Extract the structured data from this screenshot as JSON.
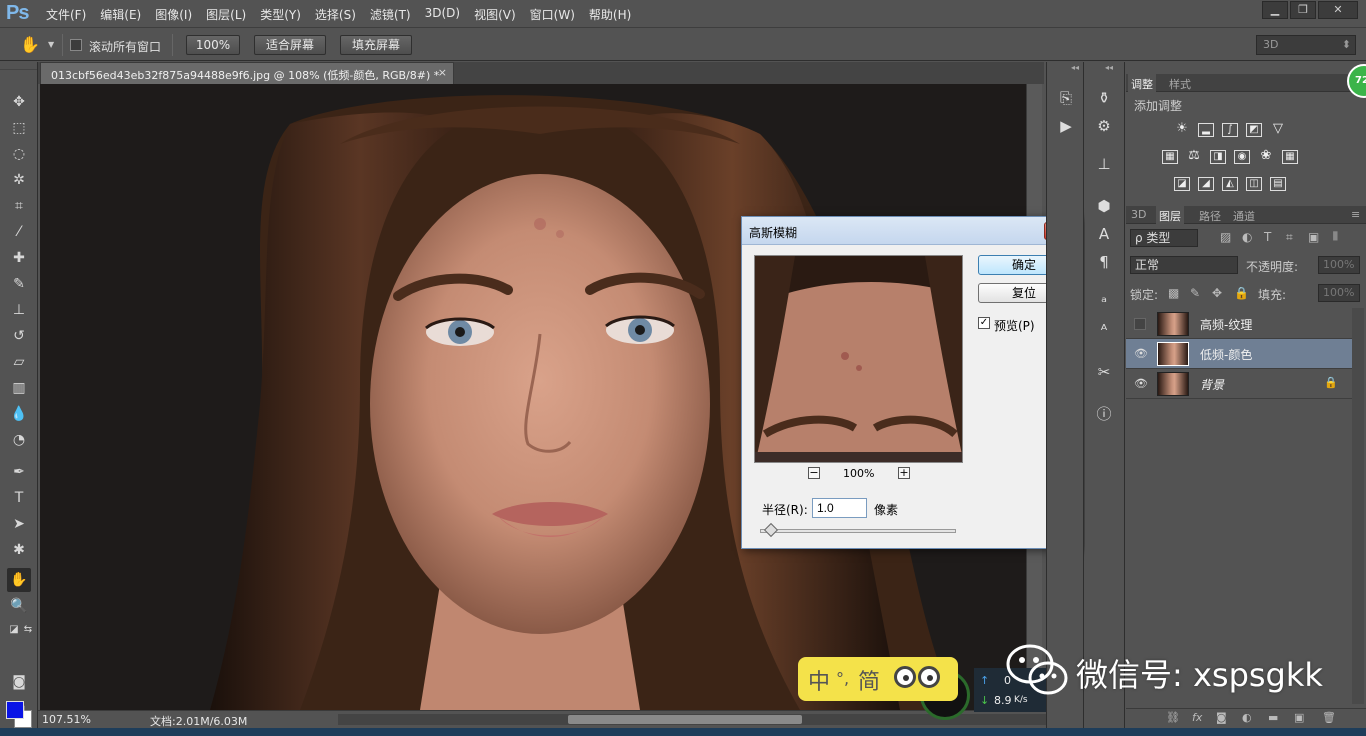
{
  "app": {
    "logo": "Ps"
  },
  "menu": [
    "文件(F)",
    "编辑(E)",
    "图像(I)",
    "图层(L)",
    "类型(Y)",
    "选择(S)",
    "滤镜(T)",
    "3D(D)",
    "视图(V)",
    "窗口(W)",
    "帮助(H)"
  ],
  "window_controls": {
    "minimize": "▁",
    "restore": "❐",
    "close": "✕"
  },
  "options": {
    "scroll_all_label": "滚动所有窗口",
    "zoom_100": "100%",
    "fit_screen": "适合屏幕",
    "fill_screen": "填充屏幕",
    "workspace": "3D"
  },
  "document": {
    "tab_title": "013cbf56ed43eb32f875a94488e9f6.jpg @ 108% (低频-颜色, RGB/8#) *",
    "tab_close": "×"
  },
  "status": {
    "zoom": "107.51%",
    "doc_size": "文档:2.01M/6.03M"
  },
  "dialog": {
    "title": "高斯模糊",
    "close": "✕",
    "ok": "确定",
    "reset": "复位",
    "preview_checked": "✓",
    "preview_label": "预览(P)",
    "zoom_minus": "−",
    "zoom_plus": "+",
    "zoom": "100%",
    "radius_label": "半径(R):",
    "radius_value": "1.0",
    "radius_unit": "像素",
    "radius_slider_fraction": 0.03
  },
  "adjust_panel": {
    "tabs": [
      "调整",
      "样式"
    ],
    "title": "添加调整"
  },
  "layers_panel": {
    "tabs": [
      "3D",
      "图层",
      "路径",
      "通道"
    ],
    "filter_kind": "ρ 类型",
    "blend_mode": "正常",
    "opacity_label": "不透明度:",
    "opacity": "100%",
    "lock_label": "锁定:",
    "fill_label": "填充:",
    "fill": "100%",
    "layers": [
      {
        "name": "高频-纹理",
        "visible": false,
        "selected": false
      },
      {
        "name": "低频-颜色",
        "visible": true,
        "selected": true
      },
      {
        "name": "背景",
        "visible": true,
        "selected": false,
        "locked": true
      }
    ],
    "bottom_icons": [
      "link-icon",
      "fx-icon",
      "mask-icon",
      "adjustment-icon",
      "folder-icon",
      "new-layer-icon",
      "trash-icon"
    ]
  },
  "overlays": {
    "ime_zh": "中",
    "ime_sep": "°,",
    "ime_simp": "简",
    "net_up": "0",
    "net_down": "8.9",
    "net_unit": "K/s",
    "watermark": "微信号: xspsgkk",
    "badge": "72"
  },
  "colors": {
    "foreground": "#0a14e6",
    "background": "#ffffff",
    "accent": "#3bb44a"
  }
}
